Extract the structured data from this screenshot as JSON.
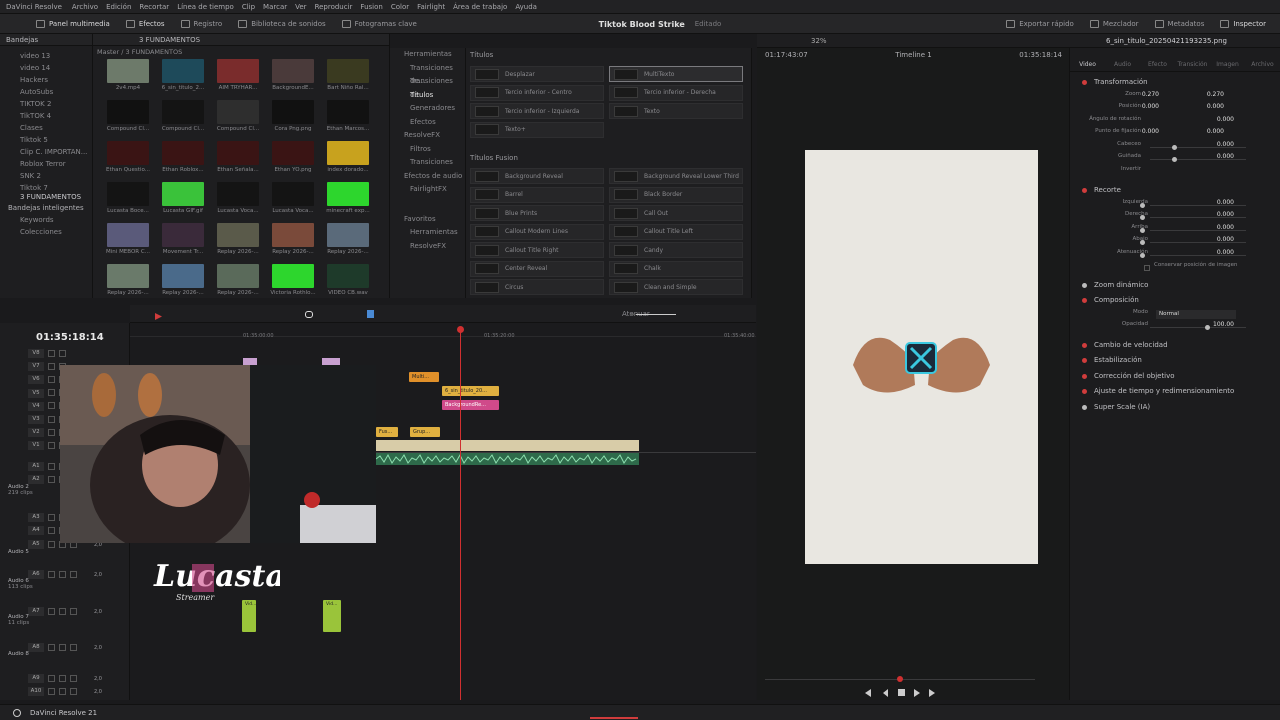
{
  "menu": [
    "DaVinci Resolve",
    "Archivo",
    "Edición",
    "Recortar",
    "Línea de tiempo",
    "Clip",
    "Marcar",
    "Ver",
    "Reproducir",
    "Fusion",
    "Color",
    "Fairlight",
    "Área de trabajo",
    "Ayuda"
  ],
  "toolbar": {
    "media_pool": "Panel multimedia",
    "effects": "Efectos",
    "registry": "Registro",
    "sound_library": "Biblioteca de sonidos",
    "keyframes": "Fotogramas clave",
    "project_name": "Tiktok Blood Strike",
    "project_state": "Editado",
    "export": "Exportar rápido",
    "mixer": "Mezclador",
    "metadata": "Metadatos",
    "inspector": "Inspector"
  },
  "bins": {
    "header": "Bandejas",
    "items": [
      "video 13",
      "video 14",
      "Hackers",
      "AutoSubs",
      "TIKTOK 2",
      "TikTOK 4",
      "Clases",
      "Tiktok 5",
      "Clip C. IMPORTAN...",
      "Roblox Terror",
      "SNK 2",
      "Tiktok 7",
      "3 FUNDAMENTOS"
    ],
    "smart_header": "Bandejas inteligentes",
    "smart_items": [
      "Keywords",
      "Colecciones"
    ]
  },
  "media": {
    "folder": "3 FUNDAMENTOS",
    "breadcrumb": "Master / 3 FUNDAMENTOS",
    "clips": [
      {
        "label": "2v4.mp4",
        "color": "#6d7a6a"
      },
      {
        "label": "6_sin_titulo_2...",
        "color": "#1e4a5a"
      },
      {
        "label": "AIM TRYHAR...",
        "color": "#7a2c2c"
      },
      {
        "label": "BackgroundE...",
        "color": "#4a3a3a"
      },
      {
        "label": "Bart Niño Ral...",
        "color": "#3a3a20"
      },
      {
        "label": "Compound Cl...",
        "color": "#111111"
      },
      {
        "label": "Compound Cl...",
        "color": "#141414"
      },
      {
        "label": "Compound Cl...",
        "color": "#2e2e2e"
      },
      {
        "label": "Cora Png.png",
        "color": "#111111"
      },
      {
        "label": "Ethan Marcos...",
        "color": "#121212"
      },
      {
        "label": "Ethan Questio...",
        "color": "#3a1414"
      },
      {
        "label": "Ethan Roblox...",
        "color": "#3a1414"
      },
      {
        "label": "Ethan Señala...",
        "color": "#3a1414"
      },
      {
        "label": "Ethan YO.png",
        "color": "#3a1414"
      },
      {
        "label": "index dorado...",
        "color": "#c8a21e"
      },
      {
        "label": "Lucasta Boce...",
        "color": "#141414"
      },
      {
        "label": "Lucasta GIF.gif",
        "color": "#3ac23a"
      },
      {
        "label": "Lucasta Voca...",
        "color": "#141414"
      },
      {
        "label": "Lucasta Voca...",
        "color": "#141414"
      },
      {
        "label": "minecraft exp...",
        "color": "#2dd62d"
      },
      {
        "label": "Mini MEBOR C...",
        "color": "#5a5a7a"
      },
      {
        "label": "Movement Tr...",
        "color": "#3a2a3a"
      },
      {
        "label": "Replay 2026-...",
        "color": "#5a5a4a"
      },
      {
        "label": "Replay 2026-...",
        "color": "#7a4a3a"
      },
      {
        "label": "Replay 2026-...",
        "color": "#5a6a7a"
      },
      {
        "label": "Replay 2026-...",
        "color": "#6a7a6a"
      },
      {
        "label": "Replay 2026-...",
        "color": "#4a6a8a"
      },
      {
        "label": "Replay 2026-...",
        "color": "#5a6a5a"
      },
      {
        "label": "Victoria Rothlo...",
        "color": "#2dd62d"
      },
      {
        "label": "VIDEO CB.wav",
        "color": "#1e3a2a"
      }
    ]
  },
  "fxnav": {
    "items": [
      "Herramientas",
      "Transiciones de...",
      "Transiciones de...",
      "Títulos",
      "Generadores",
      "Efectos",
      "ResolveFX",
      "Filtros",
      "Transiciones",
      "Efectos de audio",
      "FairlightFX"
    ],
    "favorites": "Favoritos",
    "fav_items": [
      "Herramientas",
      "ResolveFX"
    ]
  },
  "fxlist": {
    "titles_header": "Títulos",
    "titles": [
      "Desplazar",
      "MultiTexto",
      "Tercio inferior - Centro",
      "Tercio inferior - Derecha",
      "Tercio inferior - Izquierda",
      "Texto",
      "Texto+"
    ],
    "fusion_header": "Títulos Fusion",
    "fusion": [
      "Background Reveal",
      "Background Reveal Lower Third",
      "Barrel",
      "Black Border",
      "Blue Prints",
      "Call Out",
      "Callout Modern Lines",
      "Callout Title Left",
      "Callout Title Right",
      "Candy",
      "Center Reveal",
      "Chalk",
      "Circus",
      "Clean and Simple"
    ]
  },
  "timeline": {
    "timecode": "01:35:18:14",
    "ruler": [
      "01:35:00:00",
      "01:35:20:00",
      "01:35:40:00"
    ],
    "mute_label": "Atenuar",
    "video_tracks": [
      "V8",
      "V7",
      "V6",
      "V5",
      "V4",
      "V3",
      "V2",
      "V1"
    ],
    "audio_tracks": [
      "A1",
      "A2",
      "A3",
      "A4",
      "A5",
      "A6",
      "A7",
      "A8",
      "A9",
      "A10"
    ],
    "audio_labels": [
      {
        "name": "Audio 2",
        "sub": "219 clips"
      },
      {
        "name": "Audio 5",
        "sub": ""
      },
      {
        "name": "Audio 6",
        "sub": "113 clips"
      },
      {
        "name": "Audio 7",
        "sub": "11 clips"
      },
      {
        "name": "Audio 8",
        "sub": ""
      }
    ],
    "vol": "2,0",
    "clips": [
      {
        "label": "Multi...",
        "color": "#e0902a"
      },
      {
        "label": "6_sin_titulo_20...",
        "color": "#e0b040"
      },
      {
        "label": "BackgroundRe...",
        "color": "#d04a8a"
      },
      {
        "label": "Fus...",
        "color": "#e0b040"
      },
      {
        "label": "Grup...",
        "color": "#e0b040"
      },
      {
        "label": "Vid...",
        "color": "#9ac43a"
      },
      {
        "label": "Vid...",
        "color": "#9ac43a"
      }
    ]
  },
  "logo_text": "Lucasta",
  "logo_sub": "Streamer",
  "viewer": {
    "source_tc": "01:17:43:07",
    "zoom": "32%",
    "timeline_name": "Timeline 1",
    "current_tc": "01:35:18:14"
  },
  "inspector": {
    "file_name": "6_sin_titulo_20250421193235.png",
    "tabs": [
      "Video",
      "Audio",
      "Efecto",
      "Transición",
      "Imagen",
      "Archivo"
    ],
    "transform": "Transformación",
    "zoom_label": "Zoom",
    "zoom_x": "0.270",
    "zoom_y": "0.270",
    "position_label": "Posición",
    "pos_x": "0.000",
    "pos_y": "0.000",
    "rotation_label": "Ángulo de rotación",
    "rotation": "0.000",
    "anchor_label": "Punto de fijación",
    "anchor_x": "0.000",
    "anchor_y": "0.000",
    "pitch_label": "Cabeceo",
    "pitch": "0.000",
    "yaw_label": "Guiñada",
    "yaw": "0.000",
    "flip_label": "Invertir",
    "crop": "Recorte",
    "left_label": "Izquierda",
    "left": "0.000",
    "right_label": "Derecha",
    "right": "0.000",
    "top_label": "Arriba",
    "top": "0.000",
    "bottom_label": "Abajo",
    "bottom": "0.000",
    "soft_label": "Atenuación",
    "soft": "0.000",
    "retain": "Conservar posición de imagen",
    "dynamic_zoom": "Zoom dinámico",
    "composite": "Composición",
    "mode_label": "Modo",
    "mode": "Normal",
    "opacity_label": "Opacidad",
    "opacity": "100.00",
    "speed": "Cambio de velocidad",
    "stabilize": "Estabilización",
    "lens": "Corrección del objetivo",
    "retime": "Ajuste de tiempo y redimensionamiento",
    "superscale": "Super Scale (IA)"
  },
  "status": {
    "brand": "DaVinci Resolve 21"
  }
}
